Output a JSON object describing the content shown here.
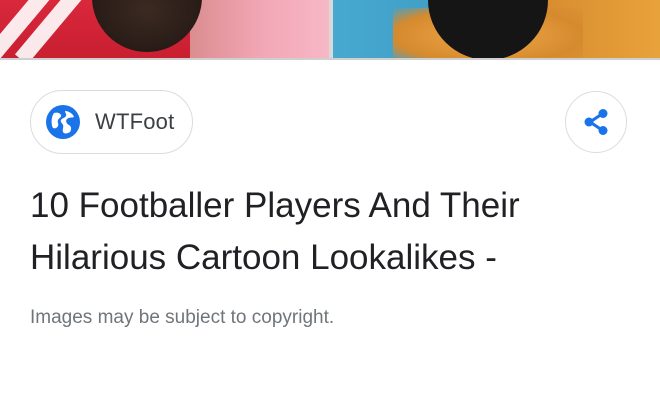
{
  "source": {
    "name": "WTFoot",
    "icon": "globe-icon"
  },
  "share": {
    "icon": "share-icon"
  },
  "title_lines": [
    "10 Footballer Players And Their",
    "Hilarious Cartoon Lookalikes -"
  ],
  "notice": "Images may be subject to copyright.",
  "colors": {
    "accent": "#1a73e8",
    "title": "#202124",
    "secondary": "#70757a",
    "chip_border": "#dadce0"
  }
}
